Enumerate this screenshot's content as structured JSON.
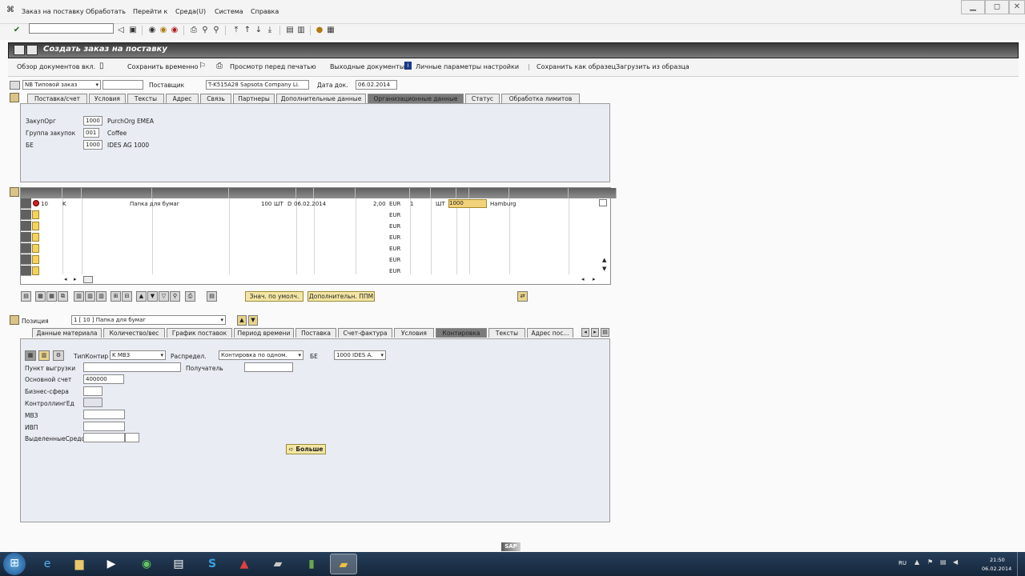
{
  "menu": {
    "items": [
      "Заказ на поставку",
      "Обработать",
      "Перейти к",
      "Среда(U)",
      "Система",
      "Справка"
    ]
  },
  "title": "Создать заказ на поставку",
  "appbar": {
    "items": [
      "Обзор документов вкл.",
      "Сохранить временно",
      "Просмотр перед печатью",
      "Выходные документы",
      "Личные параметры настройки",
      "Сохранить как образец",
      "Загрузить из образца"
    ]
  },
  "header": {
    "doc_type": "NB Типовой заказ",
    "supplier_label": "Поставщик",
    "supplier": "T-K515A28 Sapsota Company Li.",
    "doc_date_label": "Дата док.",
    "doc_date": "06.02.2014",
    "tabs": [
      "Поставка/счет",
      "Условия",
      "Тексты",
      "Адрес",
      "Связь",
      "Партнеры",
      "Дополнительные данные",
      "Организационные данные",
      "Статус",
      "Обработка лимитов"
    ],
    "active_tab_index": 7
  },
  "org": {
    "purch_org_label": "ЗакупОрг",
    "purch_org_code": "1000",
    "purch_org_name": "PurchOrg EMEA",
    "group_label": "Группа закупок",
    "group_code": "001",
    "group_name": "Coffee",
    "be_label": "БЕ",
    "be_code": "1000",
    "be_name": "IDES AG 1000"
  },
  "grid": {
    "row": {
      "pos": "10",
      "acct": "K",
      "text": "Папка для бумаг",
      "qty": "100",
      "unit": "ШТ",
      "date_flag": "D",
      "date": "06.02.2014",
      "price": "2,00",
      "currency": "EUR",
      "per": "1",
      "uom": "ШТ",
      "plant": "1000",
      "stloc": "Hamburg"
    },
    "empty_currency": "EUR"
  },
  "grid_buttons": {
    "default_values": "Знач. по умолч.",
    "additional_planning": "Дополнительн. ППМ"
  },
  "item": {
    "label": "Позиция",
    "selected": "1 [ 10 ] Папка для бумаг",
    "tabs": [
      "Данные материала",
      "Количество/вес",
      "График поставок",
      "Период времени",
      "Поставка",
      "Счет-фактура",
      "Условия",
      "Контировка",
      "Тексты",
      "Адрес пос..."
    ],
    "active_tab_index": 7
  },
  "account": {
    "type_label": "ТипКонтир",
    "type_value": "K МВЗ",
    "distrib_label": "Распредел.",
    "distrib_value": "Контировка по одном.",
    "be_label": "БЕ",
    "be_value": "1000 IDES A.",
    "unloading_label": "Пункт выгрузки",
    "recipient_label": "Получатель",
    "gl_label": "Основной счет",
    "gl_value": "400000",
    "business_area_label": "Бизнес-сфера",
    "ctrl_area_label": "КонтроллингЕд",
    "cost_center_label": "МВЗ",
    "wbs_label": "ИВП",
    "fund_label": "ВыделенныеСредст",
    "more_button": "Больше"
  },
  "taskbar": {
    "lang": "RU",
    "time": "21:50",
    "date": "06.02.2014"
  }
}
